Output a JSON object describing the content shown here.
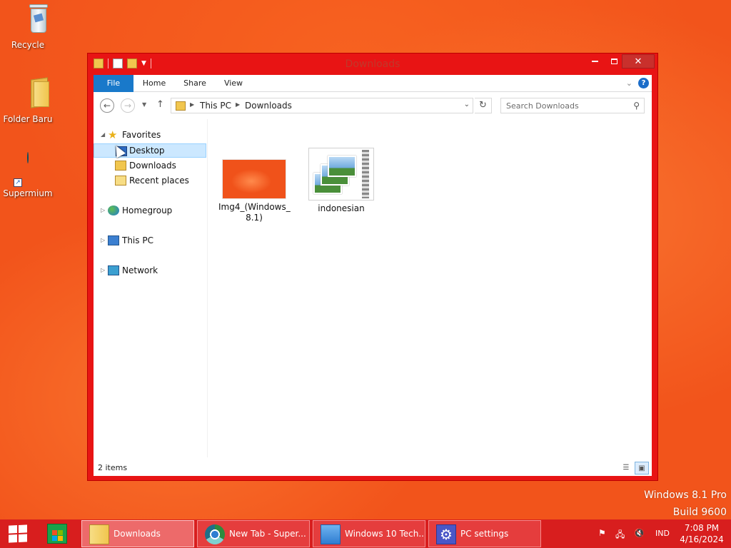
{
  "desktop": {
    "icons": [
      {
        "label": "Recycle"
      },
      {
        "label": "Folder Baru"
      },
      {
        "label": "Supermium"
      }
    ],
    "watermark": {
      "line1": "Windows 8.1 Pro",
      "line2": "Build 9600"
    }
  },
  "window": {
    "title": "Downloads",
    "ribbon": {
      "tabs": [
        "File",
        "Home",
        "Share",
        "View"
      ],
      "help": "?"
    },
    "address": {
      "crumbs": [
        "This PC",
        "Downloads"
      ]
    },
    "search": {
      "placeholder": "Search Downloads"
    },
    "nav_tree": [
      {
        "label": "Favorites"
      },
      {
        "label": "Desktop"
      },
      {
        "label": "Downloads"
      },
      {
        "label": "Recent places"
      },
      {
        "label": "Homegroup"
      },
      {
        "label": "This PC"
      },
      {
        "label": "Network"
      }
    ],
    "files": [
      {
        "name": "Img4_(Windows_ 8.1)"
      },
      {
        "name": "indonesian"
      }
    ],
    "status": "2 items"
  },
  "taskbar": {
    "buttons": [
      {
        "label": "Downloads"
      },
      {
        "label": "New Tab - Super..."
      },
      {
        "label": "Windows 10 Tech..."
      },
      {
        "label": "PC settings"
      }
    ],
    "tray": {
      "lang": "IND",
      "time": "7:08 PM",
      "date": "4/16/2024"
    }
  },
  "colors": {
    "accent": "#1979ca",
    "window_frame": "#e81414",
    "taskbar": "#d81e1e",
    "selection": "#cce8ff"
  }
}
